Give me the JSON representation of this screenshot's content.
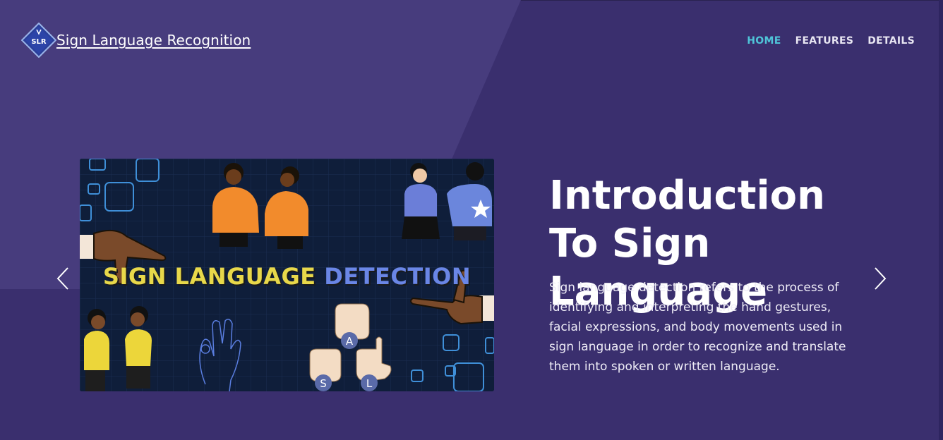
{
  "brand": {
    "name": "Sign Language Recognition",
    "logo_text": "SLR",
    "logo_icon": "slr-diamond-logo"
  },
  "nav": {
    "items": [
      {
        "label": "HOME",
        "active": true
      },
      {
        "label": "FEATURES",
        "active": false
      },
      {
        "label": "DETAILS",
        "active": false
      }
    ]
  },
  "carousel": {
    "prev_icon": "chevron-left-icon",
    "next_icon": "chevron-right-icon",
    "slide": {
      "image_text_part1": "SIGN LANGUAGE",
      "image_text_part2": "DETECTION",
      "image_letters": [
        "A",
        "S",
        "L"
      ],
      "heading": "Introduction To Sign Language",
      "description": "Sign language detection refers to the process of identifying and interpreting the hand gestures, facial expressions, and body movements used in sign language in order to recognize and translate them into spoken or written language."
    }
  },
  "colors": {
    "background": "#3a2f6e",
    "background_light": "#4a3f80",
    "nav_active": "#4fc4d8",
    "art_yellow": "#e8d84a",
    "art_blue": "#6a86e6"
  }
}
